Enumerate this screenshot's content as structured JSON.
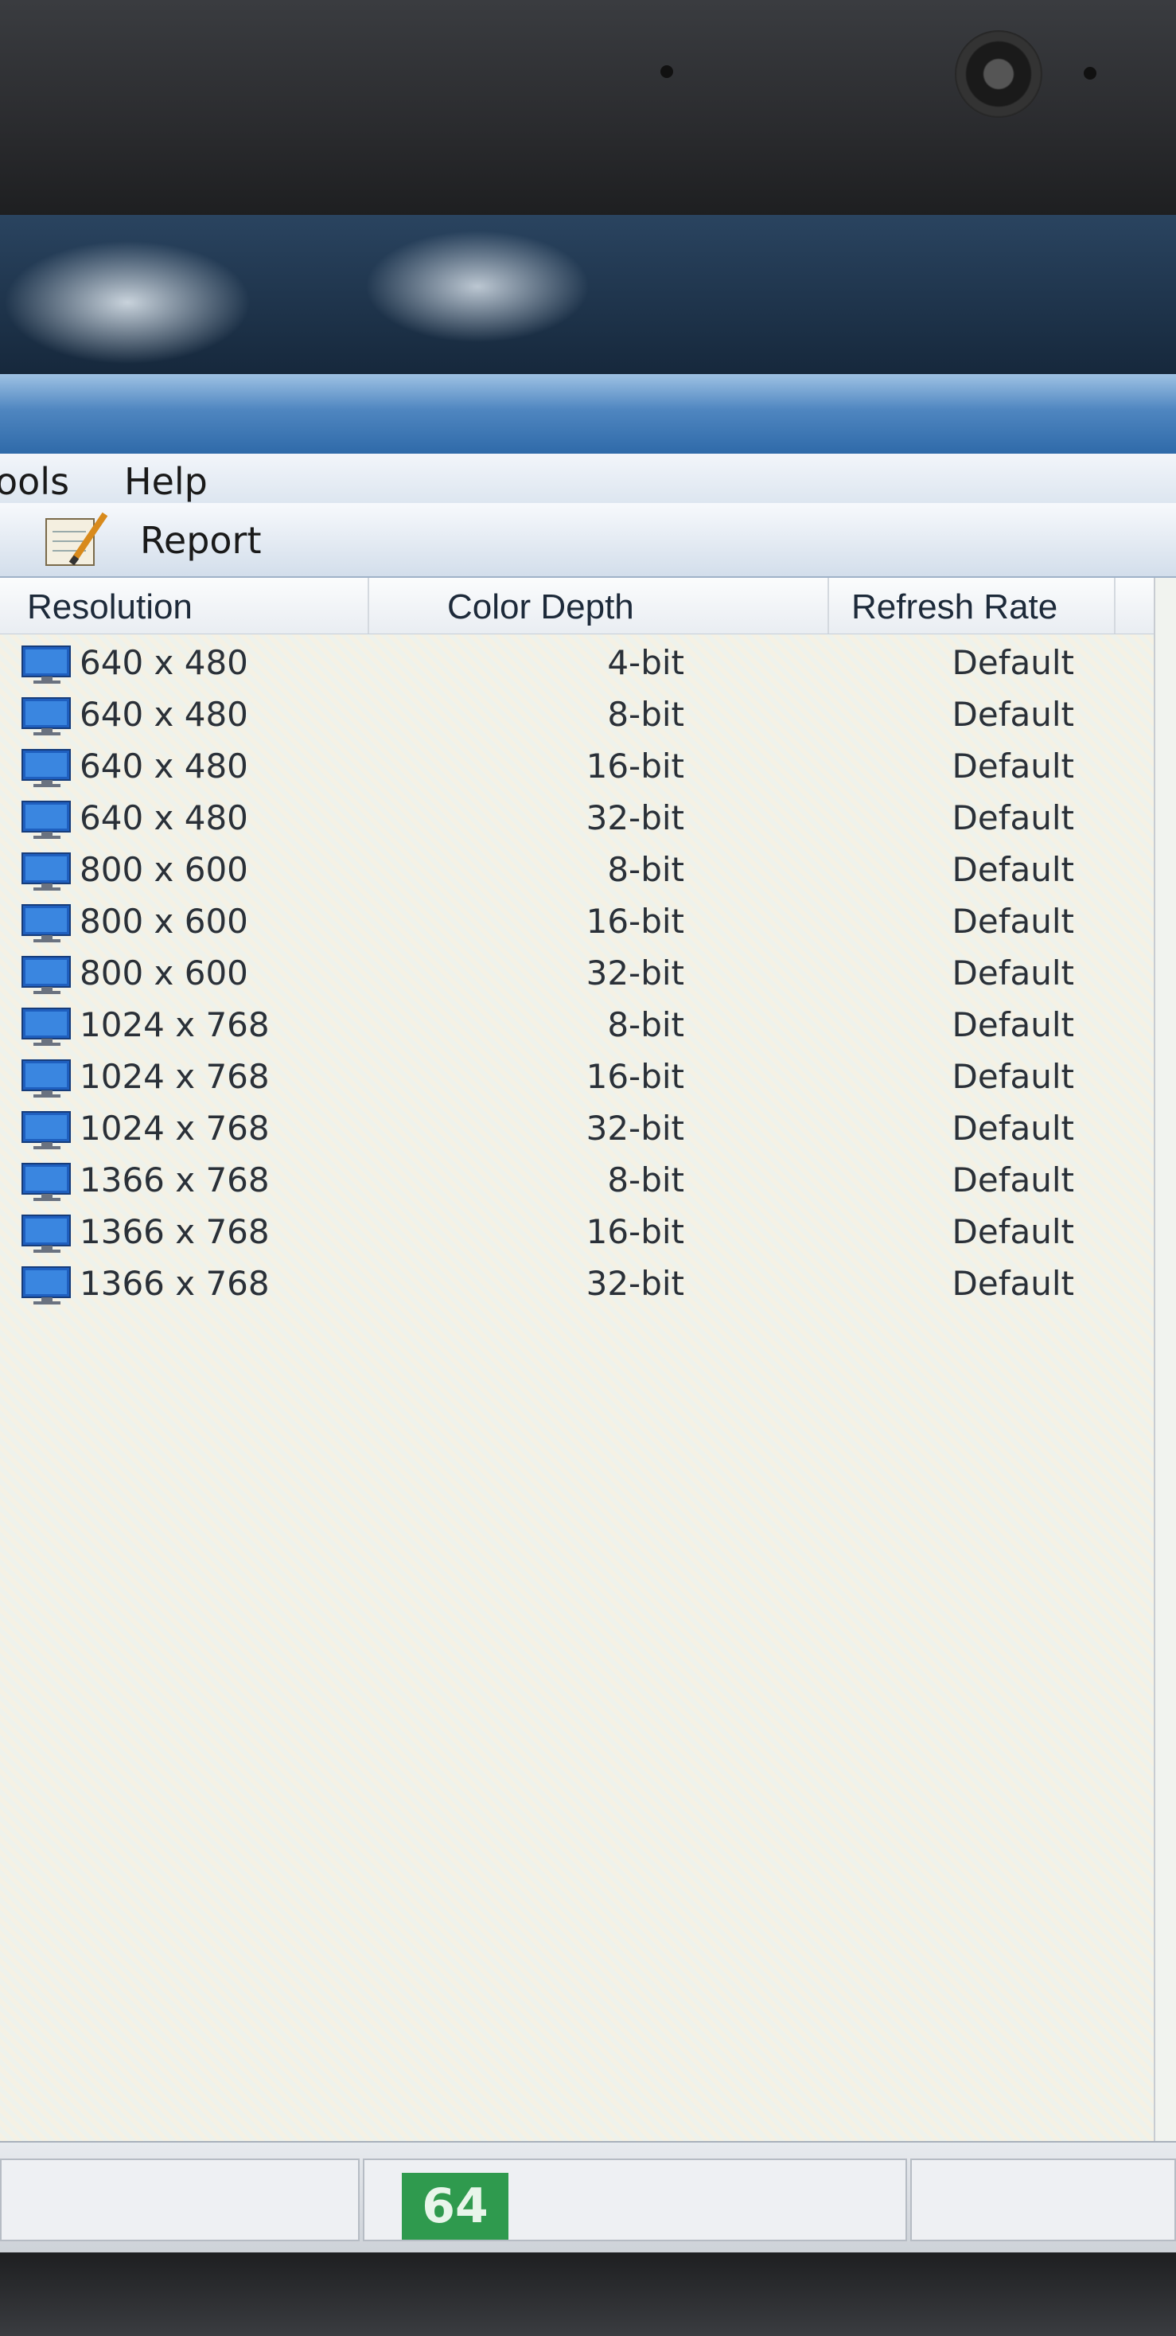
{
  "menu": {
    "items": [
      {
        "label": "ools"
      },
      {
        "label": "Help"
      }
    ]
  },
  "toolbar": {
    "report_label": "Report"
  },
  "table": {
    "headers": [
      "Resolution",
      "Color Depth",
      "Refresh Rate"
    ],
    "rows": [
      {
        "resolution": "640 x 480",
        "depth": "4-bit",
        "rate": "Default"
      },
      {
        "resolution": "640 x 480",
        "depth": "8-bit",
        "rate": "Default"
      },
      {
        "resolution": "640 x 480",
        "depth": "16-bit",
        "rate": "Default"
      },
      {
        "resolution": "640 x 480",
        "depth": "32-bit",
        "rate": "Default"
      },
      {
        "resolution": "800 x 600",
        "depth": "8-bit",
        "rate": "Default"
      },
      {
        "resolution": "800 x 600",
        "depth": "16-bit",
        "rate": "Default"
      },
      {
        "resolution": "800 x 600",
        "depth": "32-bit",
        "rate": "Default"
      },
      {
        "resolution": "1024 x 768",
        "depth": "8-bit",
        "rate": "Default"
      },
      {
        "resolution": "1024 x 768",
        "depth": "16-bit",
        "rate": "Default"
      },
      {
        "resolution": "1024 x 768",
        "depth": "32-bit",
        "rate": "Default"
      },
      {
        "resolution": "1366 x 768",
        "depth": "8-bit",
        "rate": "Default"
      },
      {
        "resolution": "1366 x 768",
        "depth": "16-bit",
        "rate": "Default"
      },
      {
        "resolution": "1366 x 768",
        "depth": "32-bit",
        "rate": "Default"
      }
    ]
  },
  "statusbar": {
    "badge": "64"
  },
  "icons": {
    "row_icon": "monitor-icon",
    "report_icon": "notepad-pencil-icon"
  },
  "colors": {
    "titlebar": "#4f86c0",
    "badge": "#2f9a4e",
    "monitor_screen": "#1f5fbf"
  }
}
